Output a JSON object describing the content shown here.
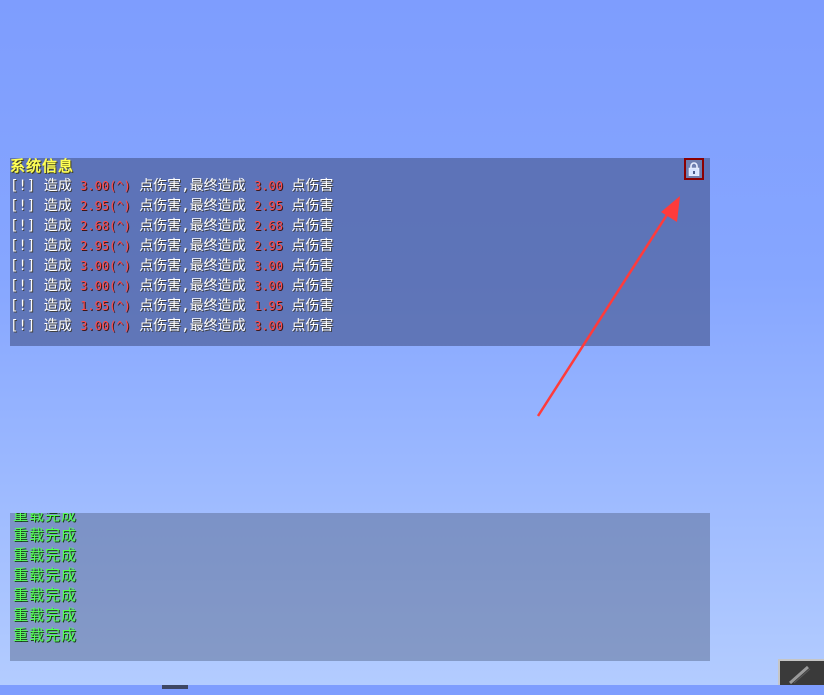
{
  "system_chat": {
    "title": "系统信息",
    "lines": [
      {
        "prefix": "[!]",
        "verb": "造成",
        "raw": "3.00(^)",
        "mid": "点伤害,最终造成",
        "final": "3.00",
        "suffix": "点伤害"
      },
      {
        "prefix": "[!]",
        "verb": "造成",
        "raw": "2.95(^)",
        "mid": "点伤害,最终造成",
        "final": "2.95",
        "suffix": "点伤害"
      },
      {
        "prefix": "[!]",
        "verb": "造成",
        "raw": "2.68(^)",
        "mid": "点伤害,最终造成",
        "final": "2.68",
        "suffix": "点伤害"
      },
      {
        "prefix": "[!]",
        "verb": "造成",
        "raw": "2.95(^)",
        "mid": "点伤害,最终造成",
        "final": "2.95",
        "suffix": "点伤害"
      },
      {
        "prefix": "[!]",
        "verb": "造成",
        "raw": "3.00(^)",
        "mid": "点伤害,最终造成",
        "final": "3.00",
        "suffix": "点伤害"
      },
      {
        "prefix": "[!]",
        "verb": "造成",
        "raw": "3.00(^)",
        "mid": "点伤害,最终造成",
        "final": "3.00",
        "suffix": "点伤害"
      },
      {
        "prefix": "[!]",
        "verb": "造成",
        "raw": "1.95(^)",
        "mid": "点伤害,最终造成",
        "final": "1.95",
        "suffix": "点伤害"
      },
      {
        "prefix": "[!]",
        "verb": "造成",
        "raw": "3.00(^)",
        "mid": "点伤害,最终造成",
        "final": "3.00",
        "suffix": "点伤害"
      }
    ],
    "lock_icon": "lock-icon"
  },
  "reload_chat": {
    "lines": [
      "重载完成",
      "重载完成",
      "重载完成",
      "重载完成",
      "重载完成",
      "重载完成",
      "重载完成"
    ]
  },
  "colors": {
    "title": "#ffff55",
    "value_red": "#ff4b4b",
    "reload_green": "#55ff55",
    "arrow": "#ff3b3b",
    "lock_border": "#8b0000"
  }
}
